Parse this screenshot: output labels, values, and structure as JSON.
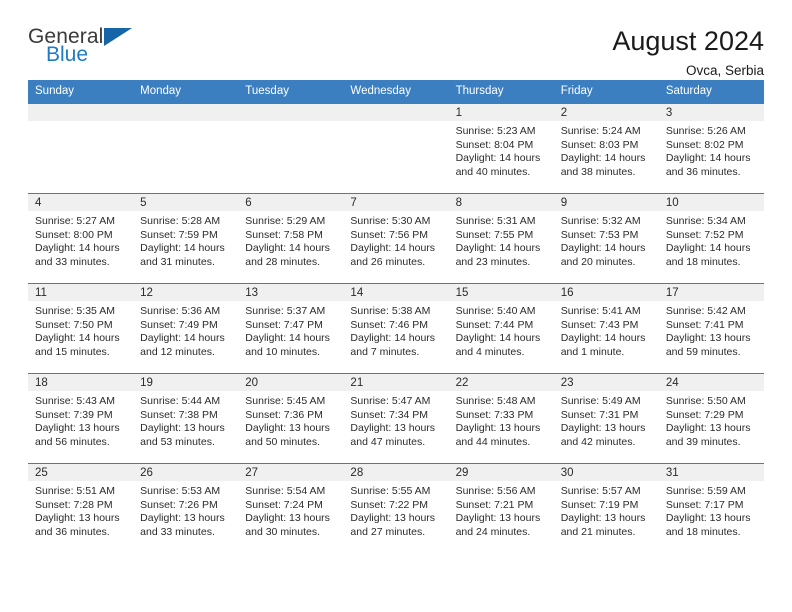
{
  "logo": {
    "text_primary": "General",
    "text_secondary": "Blue",
    "triangle_color": "#1565a8",
    "secondary_color": "#1f7ac4"
  },
  "header": {
    "title": "August 2024",
    "subtitle": "Ovca, Serbia"
  },
  "theme": {
    "header_bar_color": "#3c7fc1",
    "date_band_color": "#f0f0f0",
    "text_color": "#2b2b2b"
  },
  "weekday_headers": [
    "Sunday",
    "Monday",
    "Tuesday",
    "Wednesday",
    "Thursday",
    "Friday",
    "Saturday"
  ],
  "weeks": [
    [
      {
        "day": "",
        "sunrise": "",
        "sunset": "",
        "daylight": "",
        "empty": true
      },
      {
        "day": "",
        "sunrise": "",
        "sunset": "",
        "daylight": "",
        "empty": true
      },
      {
        "day": "",
        "sunrise": "",
        "sunset": "",
        "daylight": "",
        "empty": true
      },
      {
        "day": "",
        "sunrise": "",
        "sunset": "",
        "daylight": "",
        "empty": true
      },
      {
        "day": "1",
        "sunrise": "Sunrise: 5:23 AM",
        "sunset": "Sunset: 8:04 PM",
        "daylight": "Daylight: 14 hours and 40 minutes."
      },
      {
        "day": "2",
        "sunrise": "Sunrise: 5:24 AM",
        "sunset": "Sunset: 8:03 PM",
        "daylight": "Daylight: 14 hours and 38 minutes."
      },
      {
        "day": "3",
        "sunrise": "Sunrise: 5:26 AM",
        "sunset": "Sunset: 8:02 PM",
        "daylight": "Daylight: 14 hours and 36 minutes."
      }
    ],
    [
      {
        "day": "4",
        "sunrise": "Sunrise: 5:27 AM",
        "sunset": "Sunset: 8:00 PM",
        "daylight": "Daylight: 14 hours and 33 minutes."
      },
      {
        "day": "5",
        "sunrise": "Sunrise: 5:28 AM",
        "sunset": "Sunset: 7:59 PM",
        "daylight": "Daylight: 14 hours and 31 minutes."
      },
      {
        "day": "6",
        "sunrise": "Sunrise: 5:29 AM",
        "sunset": "Sunset: 7:58 PM",
        "daylight": "Daylight: 14 hours and 28 minutes."
      },
      {
        "day": "7",
        "sunrise": "Sunrise: 5:30 AM",
        "sunset": "Sunset: 7:56 PM",
        "daylight": "Daylight: 14 hours and 26 minutes."
      },
      {
        "day": "8",
        "sunrise": "Sunrise: 5:31 AM",
        "sunset": "Sunset: 7:55 PM",
        "daylight": "Daylight: 14 hours and 23 minutes."
      },
      {
        "day": "9",
        "sunrise": "Sunrise: 5:32 AM",
        "sunset": "Sunset: 7:53 PM",
        "daylight": "Daylight: 14 hours and 20 minutes."
      },
      {
        "day": "10",
        "sunrise": "Sunrise: 5:34 AM",
        "sunset": "Sunset: 7:52 PM",
        "daylight": "Daylight: 14 hours and 18 minutes."
      }
    ],
    [
      {
        "day": "11",
        "sunrise": "Sunrise: 5:35 AM",
        "sunset": "Sunset: 7:50 PM",
        "daylight": "Daylight: 14 hours and 15 minutes."
      },
      {
        "day": "12",
        "sunrise": "Sunrise: 5:36 AM",
        "sunset": "Sunset: 7:49 PM",
        "daylight": "Daylight: 14 hours and 12 minutes."
      },
      {
        "day": "13",
        "sunrise": "Sunrise: 5:37 AM",
        "sunset": "Sunset: 7:47 PM",
        "daylight": "Daylight: 14 hours and 10 minutes."
      },
      {
        "day": "14",
        "sunrise": "Sunrise: 5:38 AM",
        "sunset": "Sunset: 7:46 PM",
        "daylight": "Daylight: 14 hours and 7 minutes."
      },
      {
        "day": "15",
        "sunrise": "Sunrise: 5:40 AM",
        "sunset": "Sunset: 7:44 PM",
        "daylight": "Daylight: 14 hours and 4 minutes."
      },
      {
        "day": "16",
        "sunrise": "Sunrise: 5:41 AM",
        "sunset": "Sunset: 7:43 PM",
        "daylight": "Daylight: 14 hours and 1 minute."
      },
      {
        "day": "17",
        "sunrise": "Sunrise: 5:42 AM",
        "sunset": "Sunset: 7:41 PM",
        "daylight": "Daylight: 13 hours and 59 minutes."
      }
    ],
    [
      {
        "day": "18",
        "sunrise": "Sunrise: 5:43 AM",
        "sunset": "Sunset: 7:39 PM",
        "daylight": "Daylight: 13 hours and 56 minutes."
      },
      {
        "day": "19",
        "sunrise": "Sunrise: 5:44 AM",
        "sunset": "Sunset: 7:38 PM",
        "daylight": "Daylight: 13 hours and 53 minutes."
      },
      {
        "day": "20",
        "sunrise": "Sunrise: 5:45 AM",
        "sunset": "Sunset: 7:36 PM",
        "daylight": "Daylight: 13 hours and 50 minutes."
      },
      {
        "day": "21",
        "sunrise": "Sunrise: 5:47 AM",
        "sunset": "Sunset: 7:34 PM",
        "daylight": "Daylight: 13 hours and 47 minutes."
      },
      {
        "day": "22",
        "sunrise": "Sunrise: 5:48 AM",
        "sunset": "Sunset: 7:33 PM",
        "daylight": "Daylight: 13 hours and 44 minutes."
      },
      {
        "day": "23",
        "sunrise": "Sunrise: 5:49 AM",
        "sunset": "Sunset: 7:31 PM",
        "daylight": "Daylight: 13 hours and 42 minutes."
      },
      {
        "day": "24",
        "sunrise": "Sunrise: 5:50 AM",
        "sunset": "Sunset: 7:29 PM",
        "daylight": "Daylight: 13 hours and 39 minutes."
      }
    ],
    [
      {
        "day": "25",
        "sunrise": "Sunrise: 5:51 AM",
        "sunset": "Sunset: 7:28 PM",
        "daylight": "Daylight: 13 hours and 36 minutes."
      },
      {
        "day": "26",
        "sunrise": "Sunrise: 5:53 AM",
        "sunset": "Sunset: 7:26 PM",
        "daylight": "Daylight: 13 hours and 33 minutes."
      },
      {
        "day": "27",
        "sunrise": "Sunrise: 5:54 AM",
        "sunset": "Sunset: 7:24 PM",
        "daylight": "Daylight: 13 hours and 30 minutes."
      },
      {
        "day": "28",
        "sunrise": "Sunrise: 5:55 AM",
        "sunset": "Sunset: 7:22 PM",
        "daylight": "Daylight: 13 hours and 27 minutes."
      },
      {
        "day": "29",
        "sunrise": "Sunrise: 5:56 AM",
        "sunset": "Sunset: 7:21 PM",
        "daylight": "Daylight: 13 hours and 24 minutes."
      },
      {
        "day": "30",
        "sunrise": "Sunrise: 5:57 AM",
        "sunset": "Sunset: 7:19 PM",
        "daylight": "Daylight: 13 hours and 21 minutes."
      },
      {
        "day": "31",
        "sunrise": "Sunrise: 5:59 AM",
        "sunset": "Sunset: 7:17 PM",
        "daylight": "Daylight: 13 hours and 18 minutes."
      }
    ]
  ]
}
